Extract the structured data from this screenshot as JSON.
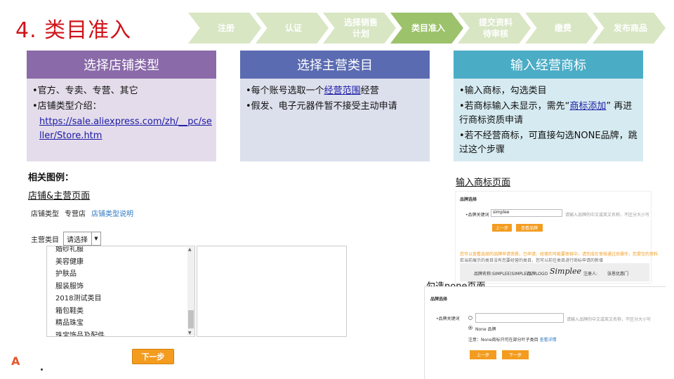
{
  "title": "4. 类目准入",
  "steps": [
    {
      "label": "注册"
    },
    {
      "label": "认证"
    },
    {
      "label": "选择销售\n计划"
    },
    {
      "label": "类目准入"
    },
    {
      "label": "提交资料\n待审核"
    },
    {
      "label": "缴费"
    },
    {
      "label": "发布商品"
    }
  ],
  "active_step": "类目准入",
  "cards": {
    "store_type": {
      "heading": "选择店铺类型",
      "line1": "•官方、专卖、专营、其它",
      "line2": "•店铺类型介绍：",
      "url": "https://sale.aliexpress.com/zh/__pc/seller/Store.htm"
    },
    "main_category": {
      "heading": "选择主营类目",
      "line1_pre": "•每个账号选取一个",
      "line1_link": "经营范围",
      "line1_post": "经营",
      "line2": "•假发、电子元器件暂不接受主动申请"
    },
    "brand": {
      "heading": "输入经营商标",
      "line1": "•输入商标，勾选类目",
      "line2_pre": "•若商标输入未显示，需先“",
      "line2_link": "商标添加",
      "line2_post": "” 再进行商标资质申请",
      "line3": "•若不经营商标，可直接勾选NONE品牌，跳过这个步骤"
    }
  },
  "left": {
    "examples_label": "相关图例：",
    "store_page_label": "店铺&主营页面",
    "shop_type_label": "店铺类型",
    "shop_type_value": "专营店",
    "shop_type_link": "店铺类型说明",
    "category_label": "主营类目",
    "category_select": "请选择",
    "categories": [
      "婚纱礼服",
      "美容健康",
      "护肤品",
      "服装服饰",
      "2018测试类目",
      "箱包鞋类",
      "精品珠宝",
      "珠宝饰品及配件"
    ],
    "next_button": "下一步"
  },
  "right": {
    "brand_page_label": "输入商标页面",
    "brand_select_title": "品牌选择",
    "brand_keyword_label": "•品牌关键词",
    "brand_keyword_value": "simplee",
    "brand_keyword_hint": "请输入品牌的中文或英文名称，不区分大小写",
    "prev_button": "上一步",
    "view_brand_button": "查看品牌",
    "warn_line1": "您可以查看选择的品牌申请资质，已申请、经营的可能要审核中，请完成在审核通过后操作，您提交的资料",
    "warn_line2": "若当前展示的类目没有您要经营的类目，您可以前往类目进行商标申请的新增",
    "brand_info_name": "品牌名称:SIMPLEE(SIMPLEE)",
    "brand_info_logo": "品牌LOGO",
    "brand_logo_text": "Simplee",
    "brand_info_holder": "注册人:",
    "brand_info_holder_value": "张恩优惠门",
    "none_page_label": "勾选none页面",
    "none_brand_title": "品牌选择",
    "none_keyword_label": "•品牌关键词",
    "none_keyword_hint": "请输入品牌的中文或英文名称，不区分大小写",
    "none_option": "None 品牌",
    "none_note_pre": "注意：None商标只可在部分叶子类目",
    "none_note_link": "查看详情",
    "prev_button2": "上一步",
    "next_button2": "下一步"
  }
}
